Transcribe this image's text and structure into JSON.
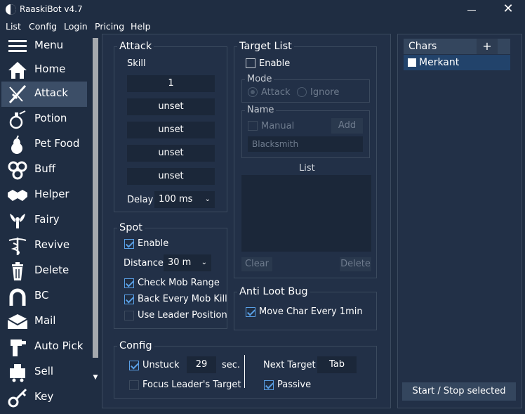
{
  "window": {
    "title": "RaaskiBot v4.7"
  },
  "menu": [
    "List",
    "Config",
    "Login",
    "Pricing",
    "Help"
  ],
  "sidebar": {
    "items": [
      {
        "label": "Menu",
        "icon": "menu-icon"
      },
      {
        "label": "Home",
        "icon": "home-icon"
      },
      {
        "label": "Attack",
        "icon": "sword-icon",
        "active": true
      },
      {
        "label": "Potion",
        "icon": "potion-icon"
      },
      {
        "label": "Pet Food",
        "icon": "pear-icon"
      },
      {
        "label": "Buff",
        "icon": "spiral-icon"
      },
      {
        "label": "Helper",
        "icon": "handshake-icon"
      },
      {
        "label": "Fairy",
        "icon": "fairy-icon"
      },
      {
        "label": "Revive",
        "icon": "caduceus-icon"
      },
      {
        "label": "Delete",
        "icon": "trash-icon"
      },
      {
        "label": "BC",
        "icon": "horseshoe-icon"
      },
      {
        "label": "Mail",
        "icon": "envelope-icon"
      },
      {
        "label": "Auto Pick",
        "icon": "pickup-hand-icon"
      },
      {
        "label": "Sell",
        "icon": "cart-icon"
      },
      {
        "label": "Key",
        "icon": "key-icon"
      }
    ]
  },
  "attack": {
    "title": "Attack",
    "skill_label": "Skill",
    "skills": [
      "1",
      "unset",
      "unset",
      "unset",
      "unset"
    ],
    "delay_label": "Delay",
    "delay_value": "100 ms"
  },
  "spot": {
    "title": "Spot",
    "enable": {
      "label": "Enable",
      "checked": true
    },
    "distance_label": "Distance",
    "distance_value": "30 m",
    "options": [
      {
        "label": "Check Mob Range",
        "checked": true
      },
      {
        "label": "Back Every Mob Kill",
        "checked": true
      },
      {
        "label": "Use Leader Position",
        "checked": false
      }
    ]
  },
  "target_list": {
    "title": "Target List",
    "enable": {
      "label": "Enable",
      "checked": false
    },
    "mode": {
      "title": "Mode",
      "options": [
        "Attack",
        "Ignore"
      ],
      "selected": "Attack"
    },
    "name": {
      "title": "Name",
      "manual_label": "Manual",
      "add_label": "Add",
      "input_value": "Blacksmith"
    },
    "list_label": "List",
    "clear_label": "Clear",
    "delete_label": "Delete"
  },
  "anti_loot": {
    "title": "Anti Loot Bug",
    "option": {
      "label": "Move Char Every 1min",
      "checked": true
    }
  },
  "config": {
    "title": "Config",
    "unstuck": {
      "label": "Unstuck",
      "checked": true,
      "value": "29",
      "unit": "sec."
    },
    "focus_leader": {
      "label": "Focus Leader's Target",
      "checked": false
    },
    "next_target_label": "Next Target",
    "next_target_value": "Tab",
    "passive": {
      "label": "Passive",
      "checked": true
    }
  },
  "chars": {
    "title": "Chars",
    "add_label": "+",
    "items": [
      {
        "name": "Merkant",
        "checked": false
      }
    ],
    "start_stop_label": "Start / Stop selected"
  },
  "colors": {
    "background": "#1f2d42",
    "panel": "#223047",
    "field": "#1b2739",
    "accent_check": "#5aa0e6",
    "active_nav": "#3c4e67",
    "selected_row": "#22436b"
  }
}
